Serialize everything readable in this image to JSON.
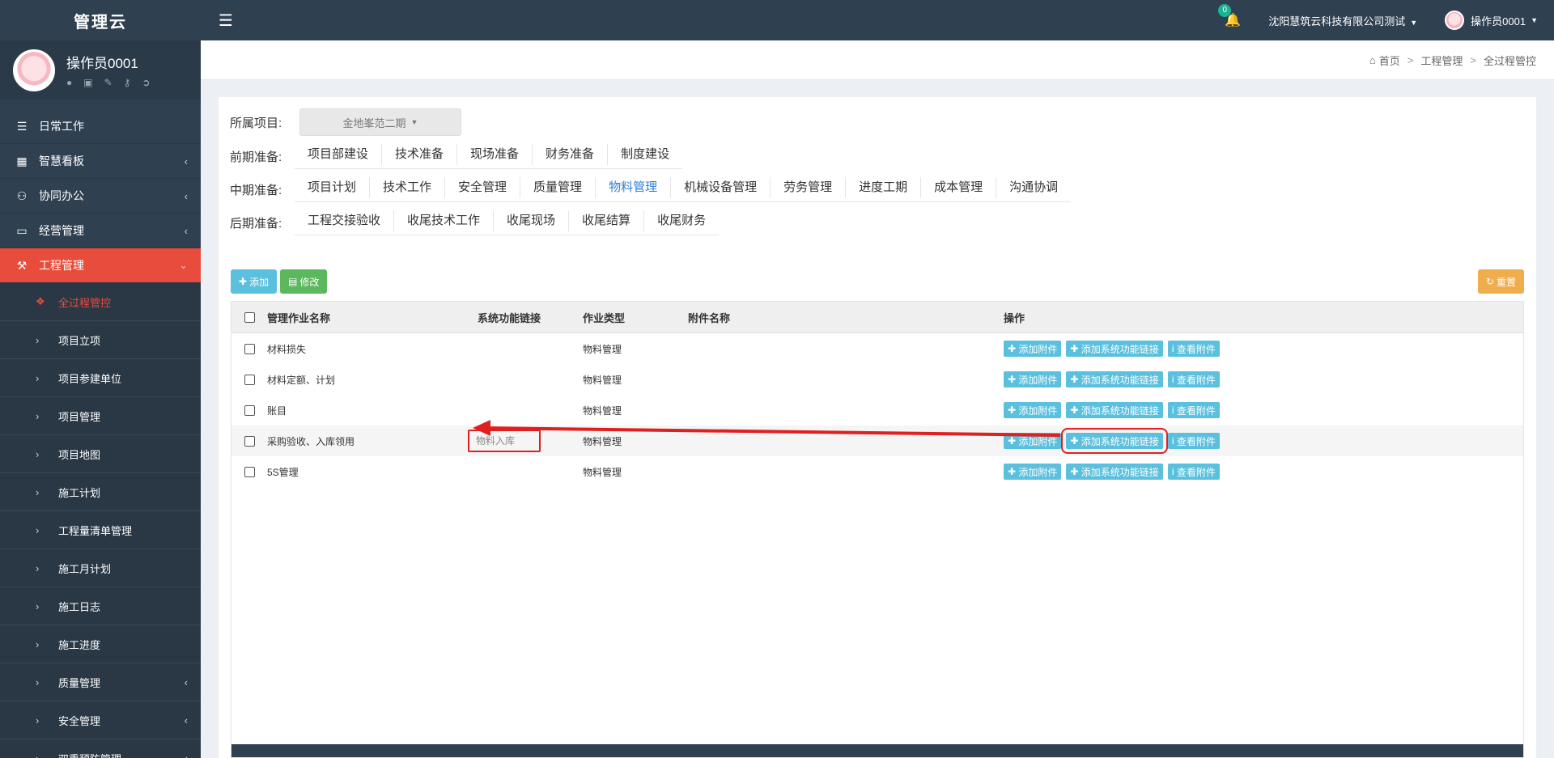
{
  "app": {
    "title": "管理云"
  },
  "user": {
    "name": "操作员0001",
    "tools": [
      "user-icon",
      "id-card-icon",
      "edit-icon",
      "key-icon",
      "logout-icon"
    ]
  },
  "sidebar": {
    "items": [
      {
        "label": "日常工作",
        "icon": "outdent-icon",
        "has_children": false
      },
      {
        "label": "智慧看板",
        "icon": "image-icon",
        "has_children": true
      },
      {
        "label": "协同办公",
        "icon": "users-icon",
        "has_children": true
      },
      {
        "label": "经营管理",
        "icon": "desktop-icon",
        "has_children": true
      },
      {
        "label": "工程管理",
        "icon": "gavel-icon",
        "has_children": true,
        "active": true
      }
    ],
    "subitems": [
      {
        "label": "全过程管控",
        "current": true
      },
      {
        "label": "项目立项"
      },
      {
        "label": "项目参建单位"
      },
      {
        "label": "项目管理"
      },
      {
        "label": "项目地图"
      },
      {
        "label": "施工计划"
      },
      {
        "label": "工程量清单管理"
      },
      {
        "label": "施工月计划"
      },
      {
        "label": "施工日志"
      },
      {
        "label": "施工进度"
      },
      {
        "label": "质量管理",
        "has_children": true
      },
      {
        "label": "安全管理",
        "has_children": true
      },
      {
        "label": "双重预防管理",
        "has_children": true
      }
    ]
  },
  "topbar": {
    "notifications": "0",
    "company": "沈阳慧筑云科技有限公司测试",
    "user": "操作员0001"
  },
  "breadcrumb": {
    "home": "首页",
    "level1": "工程管理",
    "level2": "全过程管控"
  },
  "filters": {
    "project_label": "所属项目:",
    "project_value": "金地峯范二期",
    "early_label": "前期准备:",
    "early_tabs": [
      "项目部建设",
      "技术准备",
      "现场准备",
      "财务准备",
      "制度建设"
    ],
    "mid_label": "中期准备:",
    "mid_tabs": [
      "项目计划",
      "技术工作",
      "安全管理",
      "质量管理",
      "物料管理",
      "机械设备管理",
      "劳务管理",
      "进度工期",
      "成本管理",
      "沟通协调"
    ],
    "mid_selected": "物料管理",
    "late_label": "后期准备:",
    "late_tabs": [
      "工程交接验收",
      "收尾技术工作",
      "收尾现场",
      "收尾结算",
      "收尾财务"
    ]
  },
  "toolbar": {
    "add_label": "添加",
    "edit_label": "修改",
    "reset_label": "重置"
  },
  "table": {
    "headers": {
      "name": "管理作业名称",
      "link": "系统功能链接",
      "type": "作业类型",
      "attachment": "附件名称",
      "ops": "操作"
    },
    "op_labels": {
      "add_attachment": "添加附件",
      "add_link": "添加系统功能链接",
      "view_attachment": "查看附件"
    },
    "rows": [
      {
        "name": "材料损失",
        "link": "",
        "type": "物料管理",
        "attachment": ""
      },
      {
        "name": "材料定额、计划",
        "link": "",
        "type": "物料管理",
        "attachment": ""
      },
      {
        "name": "账目",
        "link": "",
        "type": "物料管理",
        "attachment": ""
      },
      {
        "name": "采购验收、入库领用",
        "link": "物料入库",
        "type": "物料管理",
        "attachment": ""
      },
      {
        "name": "5S管理",
        "link": "",
        "type": "物料管理",
        "attachment": ""
      }
    ]
  },
  "colors": {
    "sidebar": "#2f4050",
    "active": "#e74c3c",
    "info": "#5bc0de",
    "annotation": "#e02020"
  }
}
